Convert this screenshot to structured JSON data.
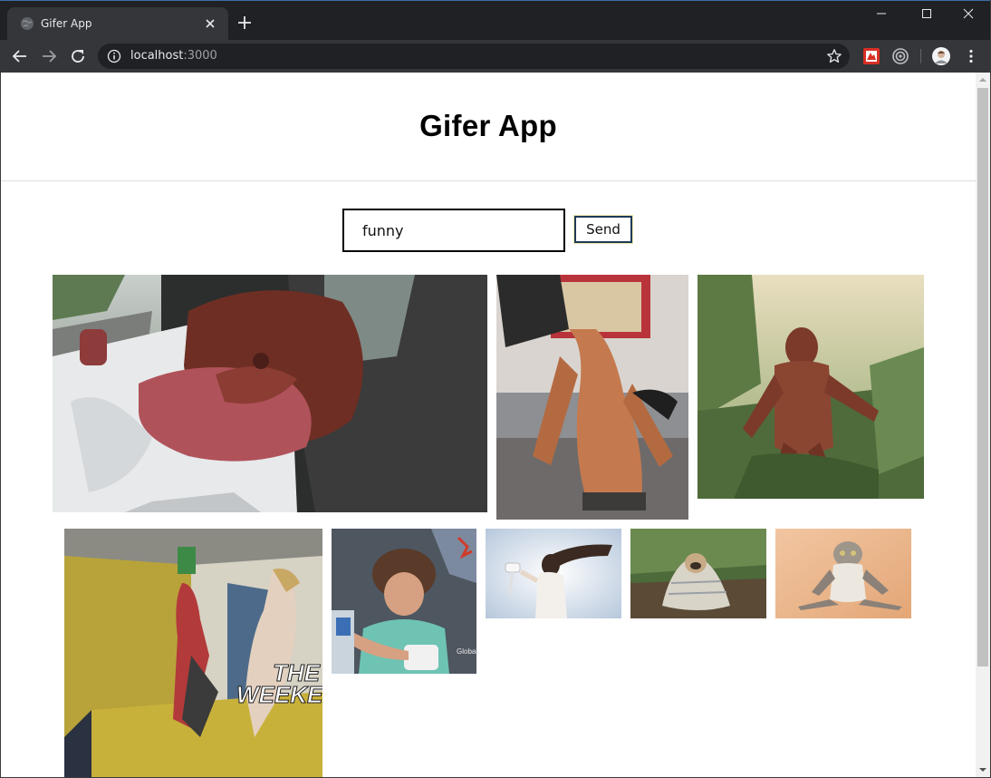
{
  "browser": {
    "tab_title": "Gifer App",
    "url_host": "localhost",
    "url_port": ":3000"
  },
  "app": {
    "title": "Gifer App",
    "search": {
      "value": "funny",
      "placeholder": ""
    },
    "send_label": "Send",
    "gif_overlay_text_line1": "THE",
    "gif_overlay_text_line2": "WEEKEN",
    "gif_watermark": "Global"
  },
  "colors": {
    "titlebar_bg": "#202124",
    "toolbar_bg": "#35363a",
    "page_bg": "#ffffff",
    "input_border": "#000000",
    "send_border": "#1f3a5a"
  },
  "icons": {
    "tab_favicon": "globe-icon",
    "back": "arrow-left-icon",
    "forward": "arrow-right-icon",
    "reload": "reload-icon",
    "info": "info-icon",
    "bookmark": "star-icon",
    "extension1": "extension-icon",
    "extension2": "target-icon",
    "profile": "avatar",
    "menu": "kebab-menu-icon"
  }
}
